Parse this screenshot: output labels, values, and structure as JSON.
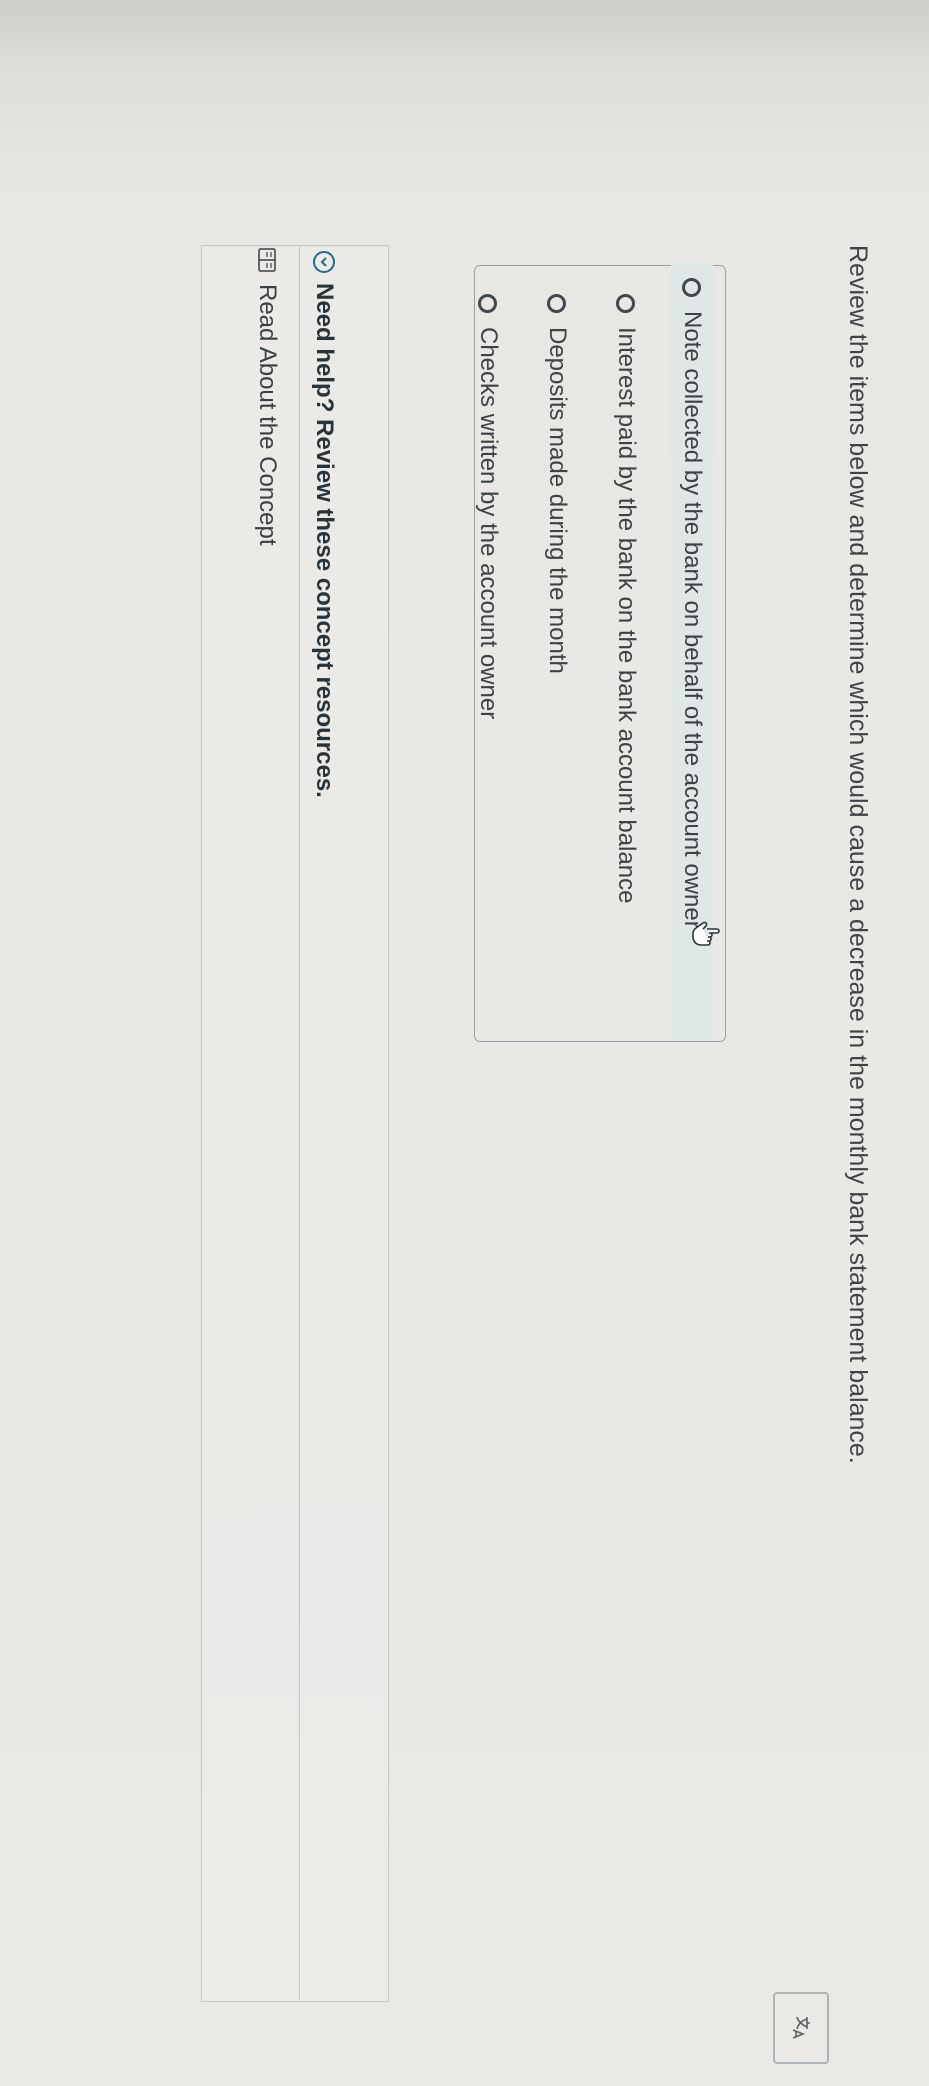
{
  "question": {
    "prompt": "Review the items below and determine which would cause a decrease in the monthly bank statement balance."
  },
  "options": [
    {
      "label": "Note collected by the bank on behalf of the account owner"
    },
    {
      "label": "Interest paid by the bank on the bank account balance"
    },
    {
      "label": "Deposits made during the month"
    },
    {
      "label": "Checks written by the account owner"
    }
  ],
  "help": {
    "toggle_label": "Need help? Review these concept resources.",
    "resources": [
      {
        "label": "Read About the Concept",
        "icon": "book-icon"
      }
    ]
  },
  "icons": {
    "toggle": "chevron-down-icon",
    "top_right": "translate-icon",
    "cursor": "hand-cursor-icon"
  },
  "colors": {
    "accent": "#1f6f83",
    "selected_background": "#dfe7e7",
    "text": "#3e4246"
  }
}
